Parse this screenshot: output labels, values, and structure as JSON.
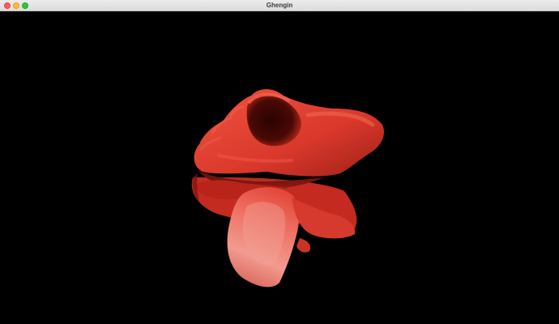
{
  "window": {
    "title": "Ghengin",
    "controls": {
      "close_color": "#ff5f57",
      "minimize_color": "#febc2e",
      "zoom_color": "#28c840"
    }
  },
  "viewport": {
    "background": "#000000",
    "object": {
      "description_color": "#d93a2c"
    }
  }
}
